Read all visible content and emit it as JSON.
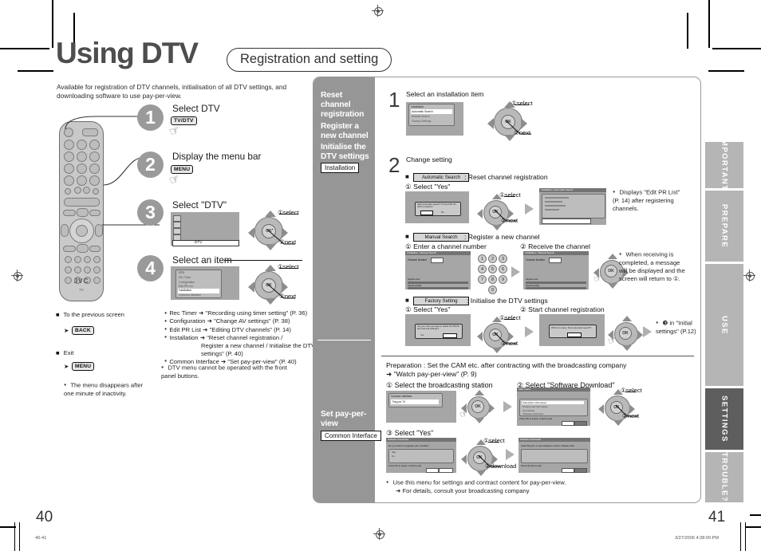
{
  "page": {
    "title": "Using DTV",
    "subtitle": "Registration and setting",
    "lead": "Available for registration of DTV channels, initialisation of all DTV settings, and downloading software to use pay-per-view.",
    "left_page_number": "40",
    "right_page_number": "41",
    "footer_left": "40-41",
    "footer_right": "3/27/2006   4:38:09 PM"
  },
  "index_tabs": [
    {
      "label": "IMPORTANT!",
      "active": false
    },
    {
      "label": "PREPARE",
      "active": false
    },
    {
      "label": "USE",
      "active": false
    },
    {
      "label": "SETTINGS",
      "active": true
    },
    {
      "label": "TROUBLE?",
      "active": false
    }
  ],
  "left_steps": [
    {
      "num": "1",
      "title": "Select DTV",
      "key": "TV/DTV"
    },
    {
      "num": "2",
      "title": "Display the menu bar",
      "key": "MENU"
    },
    {
      "num": "3",
      "title": "Select \"DTV\"",
      "callout1": "select",
      "callout2": "next"
    },
    {
      "num": "4",
      "title": "Select an item",
      "callout1": "select",
      "callout2": "next"
    }
  ],
  "menu_bar_item": "DTV",
  "dtv_menu": {
    "title": "DTV",
    "items": [
      "Rec Timer",
      "Configuration",
      "Edit PR List",
      "Installation",
      "Common Interface"
    ],
    "selected": "Installation"
  },
  "left_notes": {
    "back_label": "To the previous screen",
    "back_key": "BACK",
    "exit_label": "Exit",
    "exit_key": "MENU",
    "timeout_note": "The menu disappears after one minute of inactivity.",
    "panel_note": "DTV menu cannot be operated with the front panel buttons.",
    "cross_refs": [
      "Rec Timer ➜ \"Recording using timer setting\" (P. 36)",
      "Configuration ➜ \"Change AV settings\" (P. 38)",
      "Edit PR List ➜ \"Editing DTV channels\" (P. 14)",
      "Installation ➜ \"Reset channel registration /",
      "Register a new channel / Initialise the DTV settings\" (P. 40)",
      "Common Interface ➜ \"Set pay-per-view\" (P. 40)"
    ]
  },
  "gray_column": {
    "section1": {
      "headings": [
        "Reset channel registration",
        "Register a new channel",
        "Initialise the DTV settings"
      ],
      "chip": "Installation"
    },
    "section2": {
      "heading": "Set pay-per-view",
      "chip": "Common Interface"
    }
  },
  "right_page": {
    "step1": {
      "num": "1",
      "title": "Select an installation item",
      "osd_title": "Installation",
      "osd_items": [
        "Automatic Search",
        "Manual Search",
        "Factory Settings"
      ],
      "osd_selected": "Automatic Search",
      "callout1": "select",
      "callout2": "next"
    },
    "step2": {
      "num": "2",
      "title": "Change setting",
      "blocks": [
        {
          "tag": "Automatic Search",
          "desc": ": Reset channel registration",
          "substeps": [
            "① Select \"Yes\""
          ],
          "callout1": "select",
          "callout2": "next",
          "note": "Displays \"Edit PR List\" (P. 14) after registering channels."
        },
        {
          "tag": "Manual Search",
          "desc": ": Register a new channel",
          "substeps": [
            "① Enter a channel number",
            "② Receive the channel"
          ],
          "note": "When receiving is completed, a message will be displayed and the screen will return to ①.",
          "keypad": [
            "1",
            "2",
            "3",
            "4",
            "5",
            "6",
            "7",
            "8",
            "9",
            "0"
          ]
        },
        {
          "tag": "Factory Setting",
          "desc": ": Initialise the DTV settings",
          "substeps": [
            "① Select \"Yes\"",
            "② Start channel registration"
          ],
          "callout1": "select",
          "callout2": "next",
          "note": "❸ in \"Initial settings\" (P.12)"
        }
      ]
    },
    "ppv": {
      "preparation_line1": "Preparation : Set the CAM etc. after contracting with the broadcasting company",
      "preparation_line2": "➜ \"Watch pay-per-view\" (P. 9)",
      "substep1": "① Select the broadcasting station",
      "substep2": "② Select \"Software Download\"",
      "substep3": "③ Select \"Yes\"",
      "callout_select": "select",
      "callout_next": "next",
      "callout_download": "download",
      "note1": "Use this menu for settings and contract content for pay-per-view.",
      "note2": "➜ For details, consult your broadcasting company"
    }
  },
  "colors": {
    "gray_column": "#969696",
    "tab_inactive": "#b5b5b5",
    "tab_active": "#5e5e5e",
    "title_gray": "#4d4d4d",
    "osd_bg": "#a6a6a6"
  }
}
